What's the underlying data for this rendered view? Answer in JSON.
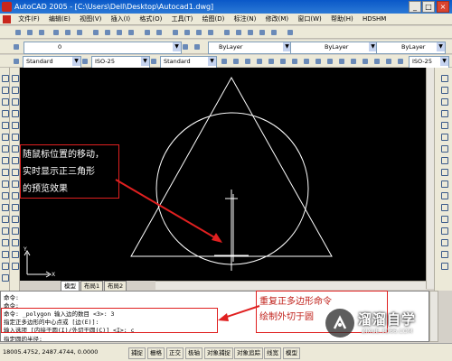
{
  "window": {
    "title": "AutoCAD 2005 - [C:\\Users\\Dell\\Desktop\\Autocad1.dwg]",
    "controls": [
      "_",
      "□",
      "×"
    ]
  },
  "menu": [
    "文件(F)",
    "编辑(E)",
    "视图(V)",
    "插入(I)",
    "格式(O)",
    "工具(T)",
    "绘图(D)",
    "标注(N)",
    "修改(M)",
    "窗口(W)",
    "帮助(H)",
    "HDSHM"
  ],
  "toolbar": {
    "layer_value": "0",
    "color_value": "ByLayer",
    "linetype_value": "ByLayer",
    "lineweight_value": "ByLayer",
    "text_style": "Standard",
    "dim_style": "ISO-25",
    "table_style": "Standard",
    "dim_style_right": "ISO-25"
  },
  "tabs": [
    "模型",
    "布局1",
    "布局2"
  ],
  "command": {
    "lines": [
      "命令:",
      "命令: _polygon 输入边的数目 <3>: 3",
      "指定正多边形的中心点或 [边(E)]:",
      "输入选项 [内接于圆(I)/外切于圆(C)] <I>: c",
      "指定圆的半径:"
    ]
  },
  "status": {
    "coords": "18005.4752, 2487.4744, 0.0000",
    "buttons": [
      "捕捉",
      "栅格",
      "正交",
      "极轴",
      "对象捕捉",
      "对象追踪",
      "线宽",
      "模型"
    ]
  },
  "annotations": {
    "note1": [
      "随鼠标位置的移动，",
      "实时显示正三角形",
      "的预览效果"
    ],
    "note2": [
      "重复正多边形命令",
      "绘制外切于圆"
    ]
  },
  "watermark": {
    "title": "溜溜自学",
    "url": "ZIXUE.3D66.COM"
  },
  "colors": {
    "titlebar": "#0a58c8",
    "canvas": "#000000",
    "annotation": "#e02020"
  }
}
